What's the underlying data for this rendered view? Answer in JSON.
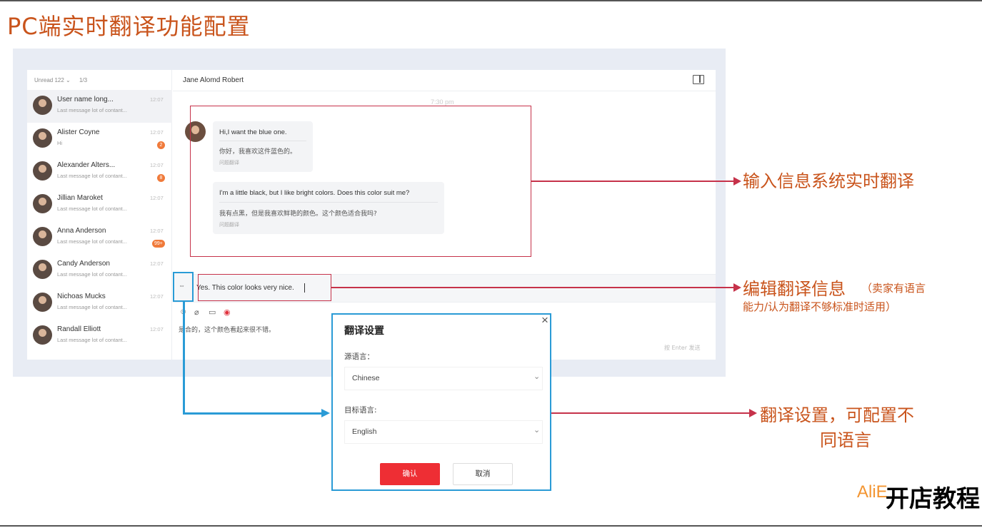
{
  "slide_title": "PC端实时翻译功能配置",
  "sidebar": {
    "filter_label": "Unread 122 ⌄",
    "count_label": "1/3",
    "contacts": [
      {
        "name": "User name long...",
        "message": "Last message lot of contant...",
        "time": "12:07",
        "badge": ""
      },
      {
        "name": "Alister Coyne",
        "message": "Hi",
        "time": "12:07",
        "badge": "2"
      },
      {
        "name": "Alexander Alters...",
        "message": "Last message lot of contant...",
        "time": "12:07",
        "badge": "8"
      },
      {
        "name": "Jillian Maroket",
        "message": "Last message lot of contant...",
        "time": "12:07",
        "badge": ""
      },
      {
        "name": "Anna Anderson",
        "message": "Last message lot of contant...",
        "time": "12:07",
        "badge": "99+"
      },
      {
        "name": "Candy Anderson",
        "message": "Last message lot of contant...",
        "time": "12:07",
        "badge": ""
      },
      {
        "name": "Nichoas Mucks",
        "message": "Last message lot of contant...",
        "time": "12:07",
        "badge": ""
      },
      {
        "name": "Randall Elliott",
        "message": "Last message lot of contant...",
        "time": "12:07",
        "badge": ""
      }
    ]
  },
  "chat": {
    "contact_name": "Jane Alomd Robert",
    "timestamp": "7:30 pm",
    "messages": [
      {
        "text": "Hi,I want the blue one.",
        "translation": "你好，我喜欢这件蓝色的。",
        "note": "问题翻译"
      },
      {
        "text": "I'm a little black, but I like bright colors. Does this color suit me?",
        "translation": "我有点黑，但是我喜欢鲜艳的颜色。这个颜色适合我吗?",
        "note": "问题翻译"
      }
    ],
    "input_value": "Yes. This color looks very nice.",
    "translate_button": "⇔",
    "translation_hint": "是合的，这个颜色看起来很不错。",
    "enter_hint": "按 Enter 发送"
  },
  "dialog": {
    "title": "翻译设置",
    "source_label": "源语言：",
    "source_value": "Chinese",
    "target_label": "目标语言:",
    "target_value": "English",
    "confirm": "确认",
    "cancel": "取消",
    "close": "×"
  },
  "annotations": {
    "a1": "输入信息系统实时翻译",
    "a2_main": "编辑翻译信息",
    "a2_sub1": "（卖家有语言",
    "a2_sub2": "能力/认为翻译不够标准时适用）",
    "a3_line1": "翻译设置，可配置不",
    "a3_line2": "同语言"
  },
  "watermark": {
    "ali": "AliE",
    "text": "开店教程"
  },
  "colors": {
    "annotation": "#c9541c",
    "highlight_red": "#c6324a",
    "highlight_blue": "#2a9bd6",
    "confirm_button": "#ee2e34"
  }
}
